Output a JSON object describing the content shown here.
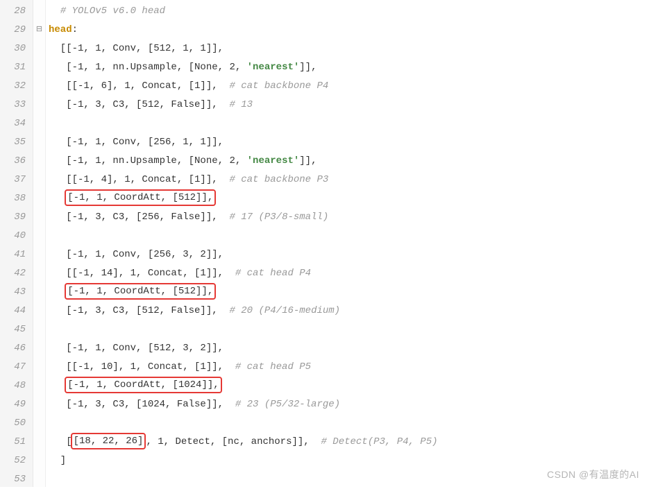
{
  "gutter": {
    "start": 28,
    "end": 53
  },
  "fold": {
    "line29": "⊟"
  },
  "lines": {
    "l28": {
      "indent": "  ",
      "comment": "# YOLOv5 v6.0 head"
    },
    "l29": {
      "key": "head",
      "colon": ":"
    },
    "l30": {
      "indent": "  ",
      "text": "[[-1, 1, Conv, [512, 1, 1]],"
    },
    "l31": {
      "indent": "   ",
      "textA": "[-1, 1, nn.Upsample, [None, 2, ",
      "string": "'nearest'",
      "textB": "]],"
    },
    "l32": {
      "indent": "   ",
      "text": "[[-1, 6], 1, Concat, [1]],  ",
      "comment": "# cat backbone P4"
    },
    "l33": {
      "indent": "   ",
      "text": "[-1, 3, C3, [512, False]],  ",
      "comment": "# 13"
    },
    "l34": {
      "blank": true
    },
    "l35": {
      "indent": "   ",
      "text": "[-1, 1, Conv, [256, 1, 1]],"
    },
    "l36": {
      "indent": "   ",
      "textA": "[-1, 1, nn.Upsample, [None, 2, ",
      "string": "'nearest'",
      "textB": "]],"
    },
    "l37": {
      "indent": "   ",
      "text": "[[-1, 4], 1, Concat, [1]],  ",
      "comment": "# cat backbone P3"
    },
    "l38": {
      "indent": "   ",
      "boxed": "[-1, 1, CoordAtt, [512]],"
    },
    "l39": {
      "indent": "   ",
      "text": "[-1, 3, C3, [256, False]],  ",
      "comment": "# 17 (P3/8-small)"
    },
    "l40": {
      "blank": true
    },
    "l41": {
      "indent": "   ",
      "text": "[-1, 1, Conv, [256, 3, 2]],"
    },
    "l42": {
      "indent": "   ",
      "text": "[[-1, 14], 1, Concat, [1]],  ",
      "comment": "# cat head P4"
    },
    "l43": {
      "indent": "   ",
      "boxed": "[-1, 1, CoordAtt, [512]],"
    },
    "l44": {
      "indent": "   ",
      "text": "[-1, 3, C3, [512, False]],  ",
      "comment": "# 20 (P4/16-medium)"
    },
    "l45": {
      "blank": true
    },
    "l46": {
      "indent": "   ",
      "text": "[-1, 1, Conv, [512, 3, 2]],"
    },
    "l47": {
      "indent": "   ",
      "text": "[[-1, 10], 1, Concat, [1]],  ",
      "comment": "# cat head P5"
    },
    "l48": {
      "indent": "   ",
      "boxed": "[-1, 1, CoordAtt, [1024]],"
    },
    "l49": {
      "indent": "   ",
      "text": "[-1, 3, C3, [1024, False]],  ",
      "comment": "# 23 (P5/32-large)"
    },
    "l50": {
      "blank": true
    },
    "l51": {
      "indent": "   ",
      "textA": "[",
      "boxed": "[18, 22, 26]",
      "textB": ", 1, Detect, [nc, anchors]],  ",
      "comment": "# Detect(P3, P4, P5)"
    },
    "l52": {
      "indent": "  ",
      "text": "]"
    },
    "l53": {
      "blank": true
    }
  },
  "watermark": "CSDN @有温度的AI"
}
